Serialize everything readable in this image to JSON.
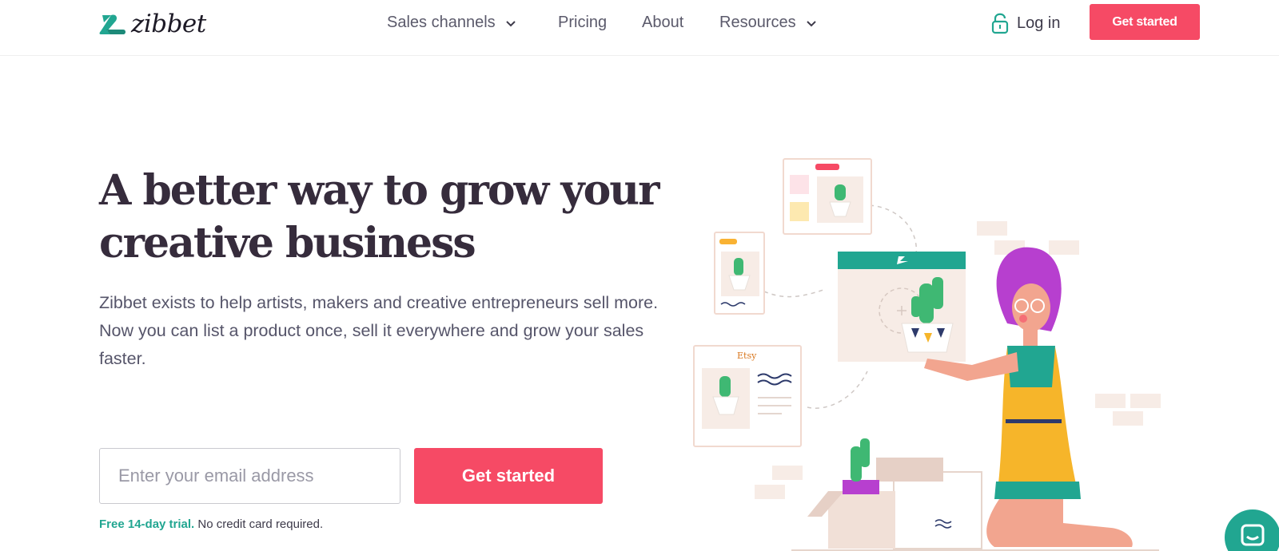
{
  "header": {
    "logo": {
      "text": "zibbet",
      "icon": "swan-icon"
    },
    "nav": [
      {
        "label": "Sales channels",
        "has_dropdown": true
      },
      {
        "label": "Pricing",
        "has_dropdown": false
      },
      {
        "label": "About",
        "has_dropdown": false
      },
      {
        "label": "Resources",
        "has_dropdown": true
      }
    ],
    "login": {
      "label": "Log in",
      "icon": "lock-icon"
    },
    "cta_label": "Get started"
  },
  "hero": {
    "headline_line1": "A better way to grow your",
    "headline_line2": "creative business",
    "subtext": "Zibbet exists to help artists, makers and creative entrepreneurs sell more. Now you can list a product once, sell it everywhere and grow your sales faster.",
    "email_placeholder": "Enter your email address",
    "cta_label": "Get started",
    "trial_highlight": "Free 14-day trial.",
    "trial_rest": " No credit card required."
  },
  "illustration": {
    "etsy_label": "Etsy"
  },
  "colors": {
    "brand_teal": "#21a691",
    "cta_red": "#f64a65",
    "heading": "#362c3c",
    "body_text": "#56556a"
  }
}
